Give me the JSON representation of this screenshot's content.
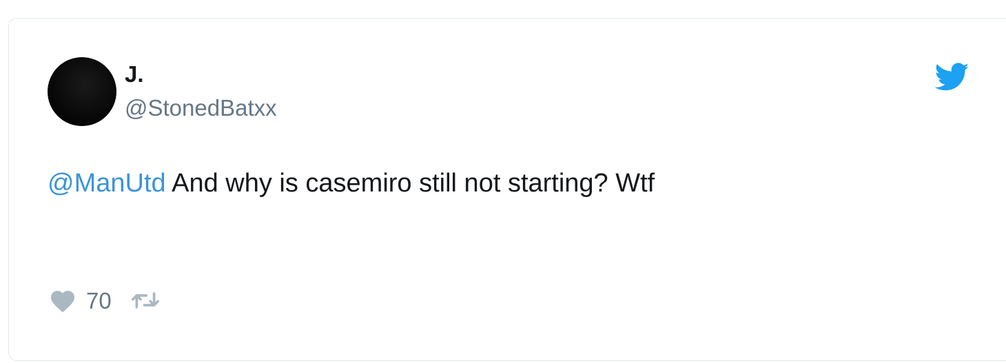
{
  "tweet": {
    "display_name": "J.",
    "handle": "@StonedBatxx",
    "mention": "@ManUtd",
    "text": " And why is casemiro still not starting? Wtf",
    "like_count": "70"
  },
  "icons": {
    "brand": "twitter-bird-icon",
    "like": "heart-icon",
    "retweet": "retweet-icon"
  },
  "colors": {
    "twitter_blue": "#1da1f2",
    "mention_blue": "#3b94d9",
    "secondary_gray": "#657786",
    "icon_gray": "#aab8c2",
    "text_dark": "#14171a"
  }
}
